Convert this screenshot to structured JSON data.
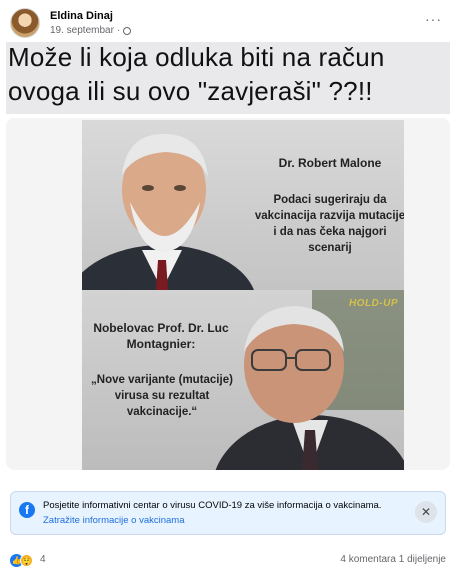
{
  "post": {
    "author": "Eldina Dinaj",
    "date": "19. septembar",
    "privacy_icon": "globe-icon",
    "more_icon": "more-dots-icon",
    "text": "Može li koja odluka biti na račun ovoga ili su ovo \"zavjeraši\" ??!!"
  },
  "image": {
    "top_name": "Dr. Robert Malone",
    "top_quote": "Podaci sugeriraju da vakcinacija razvija mutacije i da nas čeka najgori scenarij",
    "bottom_name": "Nobelovac Prof. Dr. Luc Montagnier:",
    "bottom_quote": "„Nove varijante (mutacije) virusa su rezultat vakcinacije.“",
    "watermark": "HOLD-UP"
  },
  "info_banner": {
    "title": "Posjetite informativni centar o virusu COVID-19 za više informacija o vakcinama.",
    "link": "Zatražite informacije o vakcinama",
    "icon": "facebook-icon",
    "close_icon": "close-icon"
  },
  "footer": {
    "reaction_count": "4",
    "comments": "4 komentara",
    "shares": "1 dijeljenje",
    "reaction_icons": [
      "like-icon",
      "wow-icon"
    ]
  },
  "colors": {
    "link_blue": "#216fdb",
    "facebook_blue": "#1877f2",
    "banner_bg": "#e7f3ff"
  }
}
